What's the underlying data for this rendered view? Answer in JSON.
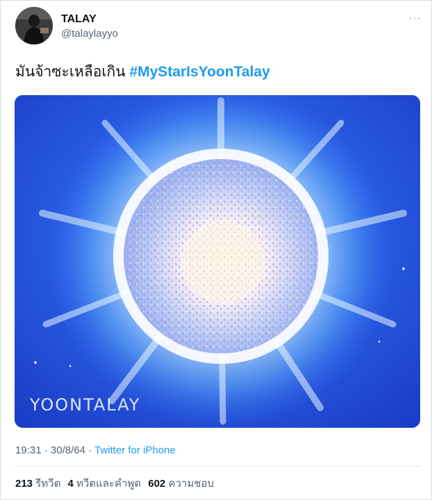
{
  "user": {
    "name": "TALAY",
    "handle": "@talaylayyo"
  },
  "tweet": {
    "text": "มันจ้าซะเหลือเกิน",
    "hashtag": "#MyStarIsYoonTalay"
  },
  "media": {
    "watermark": "YOONTALAY"
  },
  "meta": {
    "time": "19:31",
    "sep1": " · ",
    "date": "30/8/64",
    "sep2": " · ",
    "source": "Twitter for iPhone"
  },
  "stats": {
    "retweets_count": "213",
    "retweets_label": "รีทวีต",
    "quotes_count": "4",
    "quotes_label": "ทวีตและคำพูด",
    "likes_count": "602",
    "likes_label": "ความชอบ"
  },
  "colors": {
    "link": "#1d9bf0",
    "secondary_text": "#536471",
    "media_background": "#1e49d9"
  },
  "icons": {
    "more": "more-dots-icon"
  }
}
